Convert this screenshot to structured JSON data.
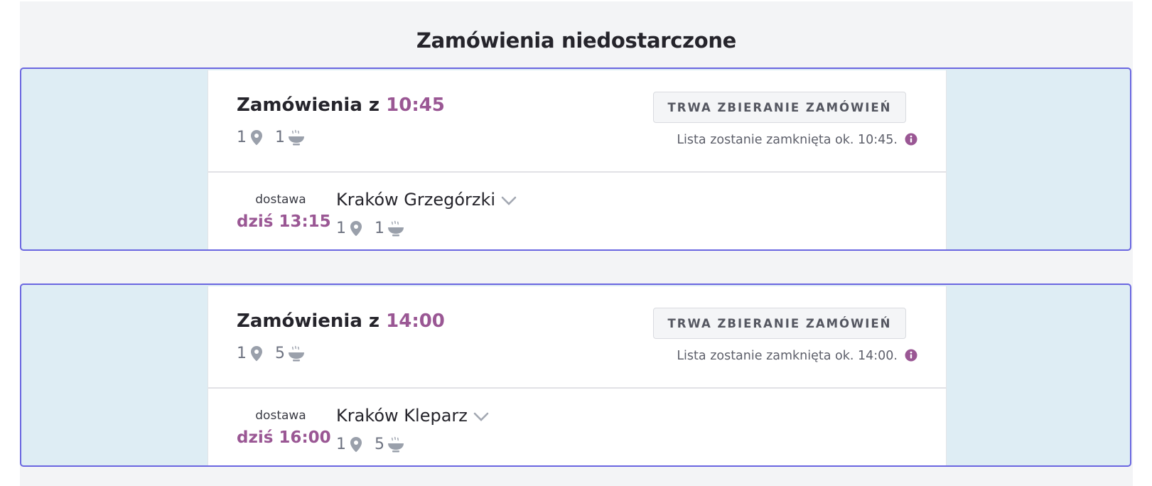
{
  "page": {
    "title": "Zamówienia niedostarczone"
  },
  "colors": {
    "accent": "#9a5794",
    "border": "#6a66e0",
    "batch_bg": "#deedf4"
  },
  "batches": [
    {
      "title_prefix": "Zamówienia z",
      "time": "10:45",
      "locations_count": "1",
      "meals_count": "1",
      "status_label": "TRWA ZBIERANIE ZAMÓWIEŃ",
      "close_note": "Lista zostanie zamknięta ok. 10:45.",
      "delivery": {
        "label": "dostawa",
        "time": "dziś 13:15",
        "location": "Kraków Grzegórzki",
        "locations_count": "1",
        "meals_count": "1"
      }
    },
    {
      "title_prefix": "Zamówienia z",
      "time": "14:00",
      "locations_count": "1",
      "meals_count": "5",
      "status_label": "TRWA ZBIERANIE ZAMÓWIEŃ",
      "close_note": "Lista zostanie zamknięta ok. 14:00.",
      "delivery": {
        "label": "dostawa",
        "time": "dziś 16:00",
        "location": "Kraków Kleparz",
        "locations_count": "1",
        "meals_count": "5"
      }
    }
  ],
  "icons": {
    "location": "pin-icon",
    "meal": "bowl-icon",
    "info": "info-icon",
    "expand": "chevron-down-icon"
  }
}
